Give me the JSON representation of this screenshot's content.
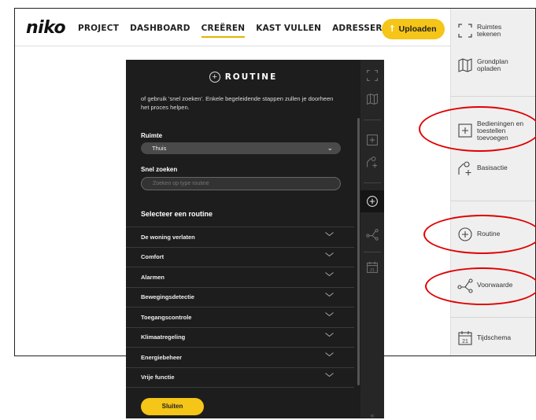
{
  "app": {
    "logo": "niko",
    "nav": [
      "PROJECT",
      "DASHBOARD",
      "CREËREN",
      "KAST VULLEN",
      "ADRESSEREN"
    ],
    "active_nav": "CREËREN",
    "upload_label": "Uploaden",
    "upload_icon": "upload-arrow-icon",
    "accent_color": "#f5c518"
  },
  "sidebar": {
    "items": [
      {
        "label": "Ruimtes\ntekenen",
        "icon": "draw-room-icon"
      },
      {
        "label": "Grondplan\nopladen",
        "icon": "floorplan-map-icon"
      },
      {
        "label": "Bedieningen en\ntoestellen\ntoevoegen",
        "icon": "add-square-icon"
      },
      {
        "label": "Basisactie",
        "icon": "basic-action-icon"
      },
      {
        "label": "Routine",
        "icon": "routine-plus-circle-icon"
      },
      {
        "label": "Voorwaarde",
        "icon": "condition-branch-icon"
      },
      {
        "label": "Tijdschema",
        "icon": "calendar-21-icon"
      }
    ],
    "annotation_color": "#e10000"
  },
  "dialog": {
    "title": "ROUTINE",
    "icon": "plus-circle-icon",
    "intro": "of gebruik 'snel zoeken'. Enkele begeleidende stappen zullen je doorheen het proces helpen.",
    "room_label": "Ruimte",
    "room_value": "Thuis",
    "search_label": "Snel zoeken",
    "search_placeholder": "Zoeken op type routine",
    "section_title": "Selecteer een routine",
    "routines": [
      "De woning verlaten",
      "Comfort",
      "Alarmen",
      "Bewegingsdetectie",
      "Toegangscontrole",
      "Klimaatregeling",
      "Energiebeheer",
      "Vrije functie"
    ],
    "close_label": "Sluiten",
    "bg_color": "#1d1d1d"
  },
  "rail": {
    "icons": [
      "draw-room-icon",
      "floorplan-map-icon",
      "add-square-icon",
      "basic-action-icon",
      "routine-plus-circle-icon",
      "condition-branch-icon",
      "calendar-21-icon"
    ],
    "calendar_day": "21",
    "collapse_glyph": "«"
  },
  "calendar_day": "21"
}
